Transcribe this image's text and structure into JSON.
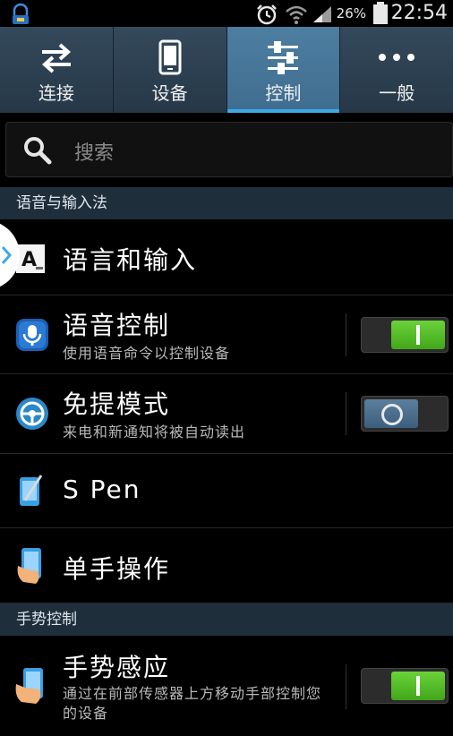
{
  "status_bar": {
    "battery_percent": "26%",
    "time": "22:54"
  },
  "tabs": [
    {
      "label": "连接",
      "icon": "swap-arrows-icon",
      "active": false
    },
    {
      "label": "设备",
      "icon": "phone-icon",
      "active": false
    },
    {
      "label": "控制",
      "icon": "sliders-icon",
      "active": true
    },
    {
      "label": "一般",
      "icon": "more-dots-icon",
      "active": false
    }
  ],
  "search": {
    "placeholder": "搜索"
  },
  "sections": {
    "language_input": "语音与输入法",
    "gesture_control": "手势控制"
  },
  "items": {
    "language_input": {
      "title": "语言和输入",
      "icon": "language-a-icon"
    },
    "voice_control": {
      "title": "语音控制",
      "subtitle": "使用语音命令以控制设备",
      "toggle": "on",
      "icon": "microphone-icon"
    },
    "hands_free": {
      "title": "免提模式",
      "subtitle": "来电和新通知将被自动读出",
      "toggle": "off",
      "icon": "steering-wheel-icon"
    },
    "s_pen": {
      "title": "S Pen",
      "icon": "s-pen-icon"
    },
    "one_hand": {
      "title": "单手操作",
      "icon": "one-hand-icon"
    },
    "motion": {
      "title": "手势感应",
      "subtitle": "通过在前部传感器上方移动手部控制您的设备",
      "toggle": "on",
      "icon": "hand-motion-icon"
    }
  },
  "colors": {
    "accent": "#3fa8e6",
    "toggle_on": "#4fbf22",
    "tab_bar": "#2c3e50"
  }
}
